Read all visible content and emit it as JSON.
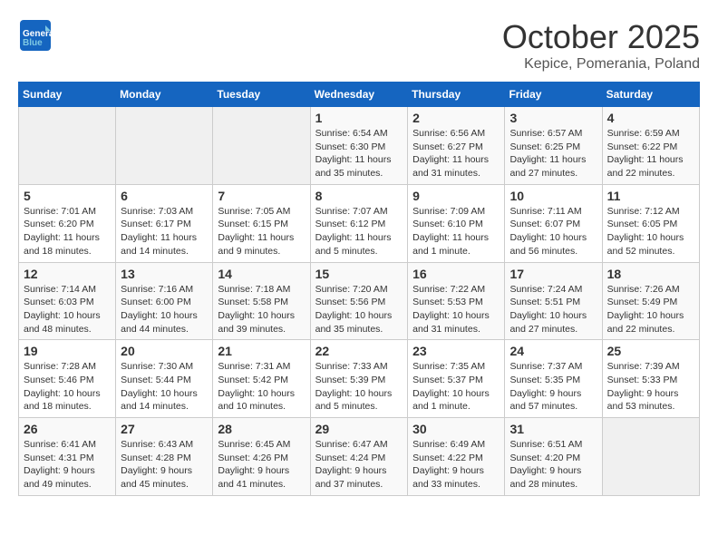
{
  "header": {
    "logo_general": "General",
    "logo_blue": "Blue",
    "month": "October 2025",
    "location": "Kepice, Pomerania, Poland"
  },
  "weekdays": [
    "Sunday",
    "Monday",
    "Tuesday",
    "Wednesday",
    "Thursday",
    "Friday",
    "Saturday"
  ],
  "weeks": [
    [
      {
        "day": "",
        "info": ""
      },
      {
        "day": "",
        "info": ""
      },
      {
        "day": "",
        "info": ""
      },
      {
        "day": "1",
        "info": "Sunrise: 6:54 AM\nSunset: 6:30 PM\nDaylight: 11 hours\nand 35 minutes."
      },
      {
        "day": "2",
        "info": "Sunrise: 6:56 AM\nSunset: 6:27 PM\nDaylight: 11 hours\nand 31 minutes."
      },
      {
        "day": "3",
        "info": "Sunrise: 6:57 AM\nSunset: 6:25 PM\nDaylight: 11 hours\nand 27 minutes."
      },
      {
        "day": "4",
        "info": "Sunrise: 6:59 AM\nSunset: 6:22 PM\nDaylight: 11 hours\nand 22 minutes."
      }
    ],
    [
      {
        "day": "5",
        "info": "Sunrise: 7:01 AM\nSunset: 6:20 PM\nDaylight: 11 hours\nand 18 minutes."
      },
      {
        "day": "6",
        "info": "Sunrise: 7:03 AM\nSunset: 6:17 PM\nDaylight: 11 hours\nand 14 minutes."
      },
      {
        "day": "7",
        "info": "Sunrise: 7:05 AM\nSunset: 6:15 PM\nDaylight: 11 hours\nand 9 minutes."
      },
      {
        "day": "8",
        "info": "Sunrise: 7:07 AM\nSunset: 6:12 PM\nDaylight: 11 hours\nand 5 minutes."
      },
      {
        "day": "9",
        "info": "Sunrise: 7:09 AM\nSunset: 6:10 PM\nDaylight: 11 hours\nand 1 minute."
      },
      {
        "day": "10",
        "info": "Sunrise: 7:11 AM\nSunset: 6:07 PM\nDaylight: 10 hours\nand 56 minutes."
      },
      {
        "day": "11",
        "info": "Sunrise: 7:12 AM\nSunset: 6:05 PM\nDaylight: 10 hours\nand 52 minutes."
      }
    ],
    [
      {
        "day": "12",
        "info": "Sunrise: 7:14 AM\nSunset: 6:03 PM\nDaylight: 10 hours\nand 48 minutes."
      },
      {
        "day": "13",
        "info": "Sunrise: 7:16 AM\nSunset: 6:00 PM\nDaylight: 10 hours\nand 44 minutes."
      },
      {
        "day": "14",
        "info": "Sunrise: 7:18 AM\nSunset: 5:58 PM\nDaylight: 10 hours\nand 39 minutes."
      },
      {
        "day": "15",
        "info": "Sunrise: 7:20 AM\nSunset: 5:56 PM\nDaylight: 10 hours\nand 35 minutes."
      },
      {
        "day": "16",
        "info": "Sunrise: 7:22 AM\nSunset: 5:53 PM\nDaylight: 10 hours\nand 31 minutes."
      },
      {
        "day": "17",
        "info": "Sunrise: 7:24 AM\nSunset: 5:51 PM\nDaylight: 10 hours\nand 27 minutes."
      },
      {
        "day": "18",
        "info": "Sunrise: 7:26 AM\nSunset: 5:49 PM\nDaylight: 10 hours\nand 22 minutes."
      }
    ],
    [
      {
        "day": "19",
        "info": "Sunrise: 7:28 AM\nSunset: 5:46 PM\nDaylight: 10 hours\nand 18 minutes."
      },
      {
        "day": "20",
        "info": "Sunrise: 7:30 AM\nSunset: 5:44 PM\nDaylight: 10 hours\nand 14 minutes."
      },
      {
        "day": "21",
        "info": "Sunrise: 7:31 AM\nSunset: 5:42 PM\nDaylight: 10 hours\nand 10 minutes."
      },
      {
        "day": "22",
        "info": "Sunrise: 7:33 AM\nSunset: 5:39 PM\nDaylight: 10 hours\nand 5 minutes."
      },
      {
        "day": "23",
        "info": "Sunrise: 7:35 AM\nSunset: 5:37 PM\nDaylight: 10 hours\nand 1 minute."
      },
      {
        "day": "24",
        "info": "Sunrise: 7:37 AM\nSunset: 5:35 PM\nDaylight: 9 hours\nand 57 minutes."
      },
      {
        "day": "25",
        "info": "Sunrise: 7:39 AM\nSunset: 5:33 PM\nDaylight: 9 hours\nand 53 minutes."
      }
    ],
    [
      {
        "day": "26",
        "info": "Sunrise: 6:41 AM\nSunset: 4:31 PM\nDaylight: 9 hours\nand 49 minutes."
      },
      {
        "day": "27",
        "info": "Sunrise: 6:43 AM\nSunset: 4:28 PM\nDaylight: 9 hours\nand 45 minutes."
      },
      {
        "day": "28",
        "info": "Sunrise: 6:45 AM\nSunset: 4:26 PM\nDaylight: 9 hours\nand 41 minutes."
      },
      {
        "day": "29",
        "info": "Sunrise: 6:47 AM\nSunset: 4:24 PM\nDaylight: 9 hours\nand 37 minutes."
      },
      {
        "day": "30",
        "info": "Sunrise: 6:49 AM\nSunset: 4:22 PM\nDaylight: 9 hours\nand 33 minutes."
      },
      {
        "day": "31",
        "info": "Sunrise: 6:51 AM\nSunset: 4:20 PM\nDaylight: 9 hours\nand 28 minutes."
      },
      {
        "day": "",
        "info": ""
      }
    ]
  ]
}
